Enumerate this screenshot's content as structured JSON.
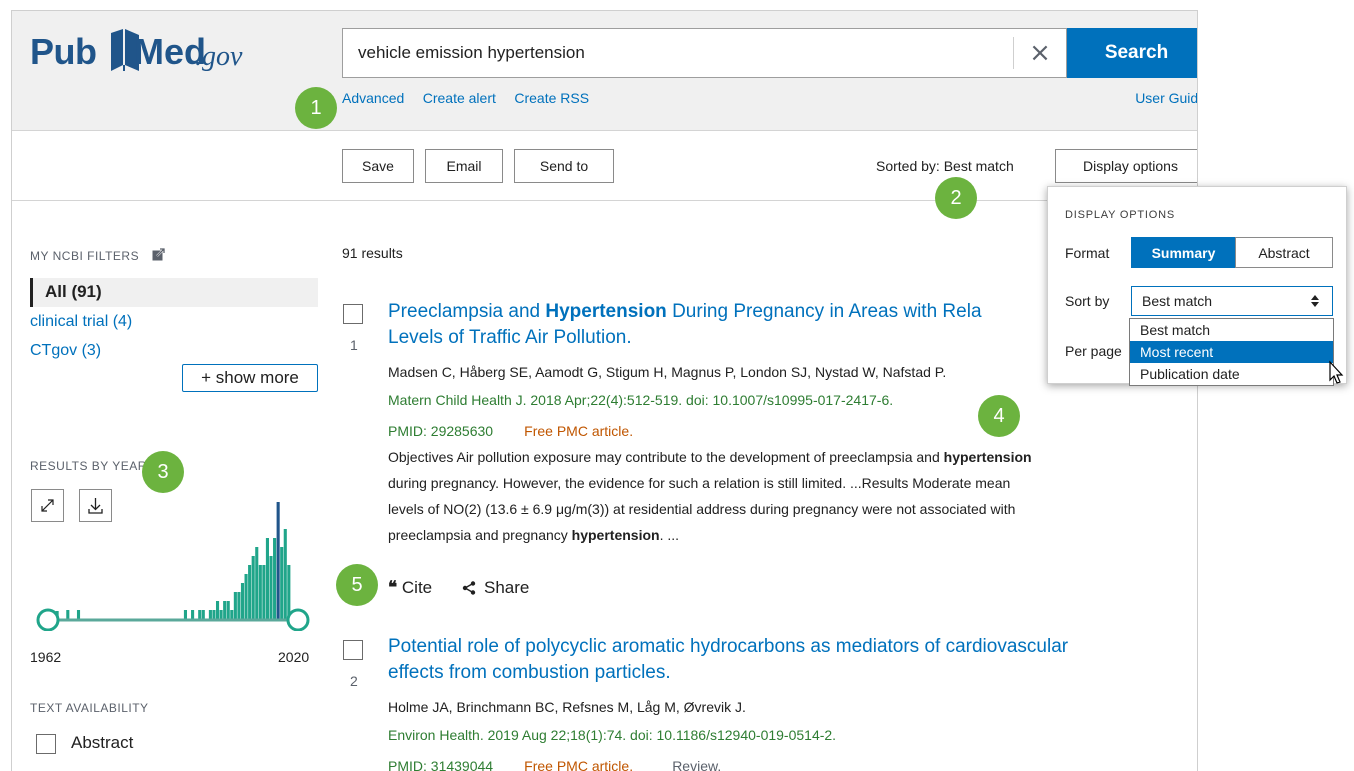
{
  "header": {
    "logo_pub": "Pub",
    "logo_med": "Med",
    "logo_gov": ".gov",
    "search_value": "vehicle emission hypertension",
    "clear_label": "×",
    "search_button": "Search",
    "links": [
      "Advanced",
      "Create alert",
      "Create RSS"
    ],
    "user_guide": "User Guide"
  },
  "toolbar": {
    "save": "Save",
    "email": "Email",
    "send_to": "Send to",
    "sorted_by": "Sorted by: Best match",
    "display_options": "Display options"
  },
  "sidebar": {
    "my_filters_heading": "MY NCBI FILTERS",
    "filters": [
      {
        "label": "All (91)"
      },
      {
        "label": "clinical trial (4)"
      },
      {
        "label": "CTgov (3)"
      }
    ],
    "show_more": "+ show more",
    "results_by_year_heading": "RESULTS BY YEAR",
    "year_start": "1962",
    "year_end": "2020",
    "year_range": [
      1962,
      2020
    ],
    "text_availability_heading": "TEXT AVAILABILITY",
    "availability": [
      {
        "label": "Abstract"
      }
    ]
  },
  "results": {
    "count": "91 results",
    "items": [
      {
        "number": "1",
        "title_pre": "Preeclampsia and ",
        "title_bold": "Hypertension",
        "title_post": " During Pregnancy in Areas with Rela",
        "title_line2": "Levels of Traffic Air Pollution.",
        "authors": "Madsen C, Håberg SE, Aamodt G, Stigum H, Magnus P, London SJ, Nystad W, Nafstad P.",
        "journal": "Matern Child Health J. 2018 Apr;22(4):512-519. doi: 10.1007/s10995-017-2417-6.",
        "pmid": "PMID: 29285630",
        "free": "Free PMC article.",
        "snippet1_pre": "Objectives Air pollution exposure may contribute to the development of preeclampsia and ",
        "snippet1_bold": "hypertension",
        "snippet2": "during pregnancy. However, the evidence for such a relation is still limited. ...Results Moderate mean",
        "snippet3": "levels of NO(2) (13.6 ± 6.9 μg/m(3)) at residential address during pregnancy were not associated with",
        "snippet4_pre": "preeclampsia and pregnancy ",
        "snippet4_bold": "hypertension",
        "snippet4_post": ". ...",
        "cite": "Cite",
        "share": "Share"
      },
      {
        "number": "2",
        "title_line1": "Potential role of polycyclic aromatic hydrocarbons as mediators of cardiovascular",
        "title_line2": "effects from combustion particles.",
        "authors": "Holme JA, Brinchmann BC, Refsnes M, Låg M, Øvrevik J.",
        "journal": "Environ Health. 2019 Aug 22;18(1):74. doi: 10.1186/s12940-019-0514-2.",
        "pmid": "PMID: 31439044",
        "free": "Free PMC article.",
        "type": "Review."
      }
    ]
  },
  "display_popup": {
    "heading": "DISPLAY OPTIONS",
    "format_label": "Format",
    "format_options": [
      "Summary",
      "Abstract"
    ],
    "format_selected": "Summary",
    "sort_label": "Sort by",
    "sort_selected": "Best match",
    "sort_options": [
      "Best match",
      "Most recent",
      "Publication date"
    ],
    "sort_highlighted": "Most recent",
    "per_page_label": "Per page"
  },
  "badges": [
    "1",
    "2",
    "3",
    "4",
    "5"
  ],
  "colors": {
    "accent": "#0071bc",
    "badge": "#6cb33f",
    "histogram": "#20a58a",
    "histogram_highlight": "#20558a"
  }
}
